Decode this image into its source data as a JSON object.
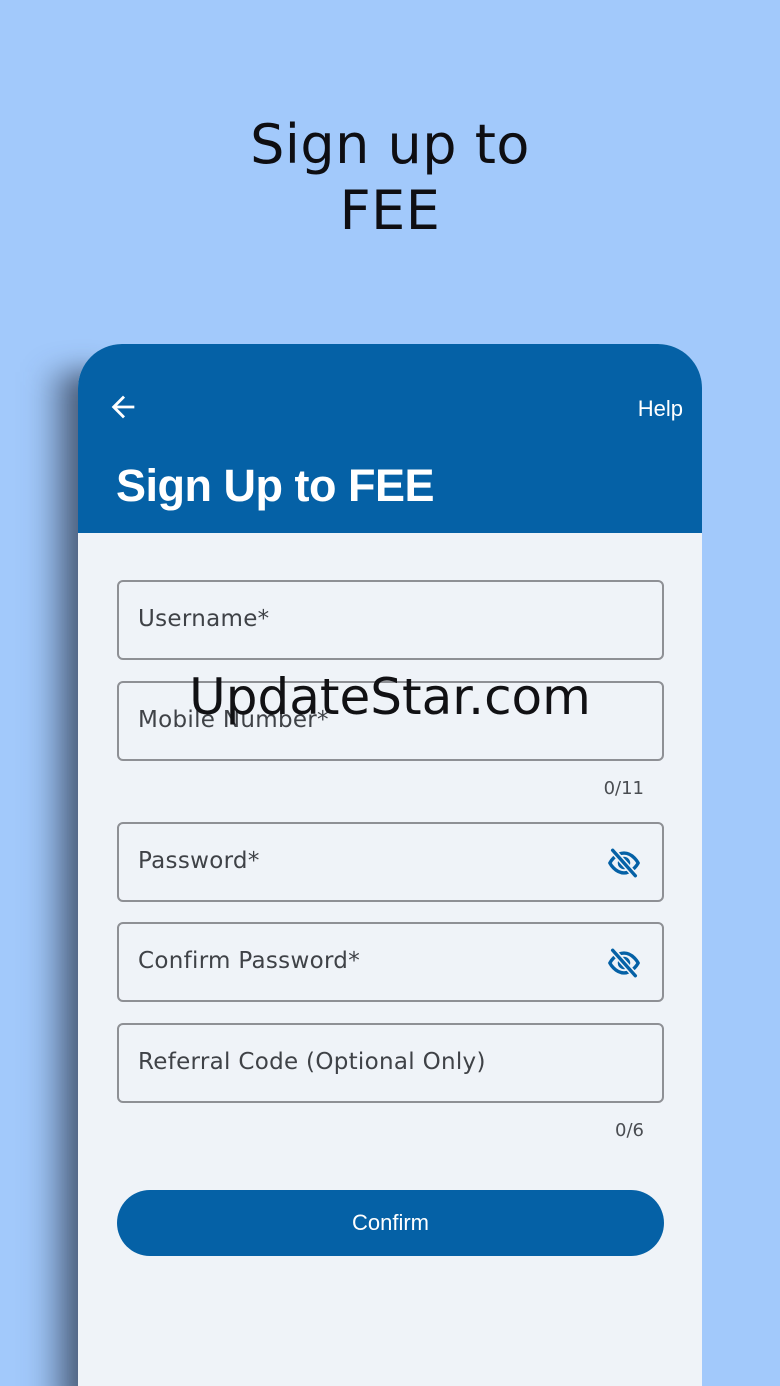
{
  "promo": {
    "title_line1": "Sign up to",
    "title_line2": "FEE"
  },
  "appbar": {
    "back_icon": "arrow-left-icon",
    "help_label": "Help",
    "title": "Sign Up to FEE"
  },
  "form": {
    "username": {
      "label": "Username*"
    },
    "mobile": {
      "label": "Mobile Number*",
      "counter": "0/11"
    },
    "password": {
      "label": "Password*",
      "icon": "eye-off-icon"
    },
    "confirm_password": {
      "label": "Confirm Password*",
      "icon": "eye-off-icon"
    },
    "referral": {
      "label": "Referral Code (Optional Only)",
      "counter": "0/6"
    },
    "confirm_label": "Confirm"
  },
  "watermark": "UpdateStar.com",
  "colors": {
    "background": "#a2c9fb",
    "primary": "#0561a6",
    "surface": "#eff3f8"
  }
}
